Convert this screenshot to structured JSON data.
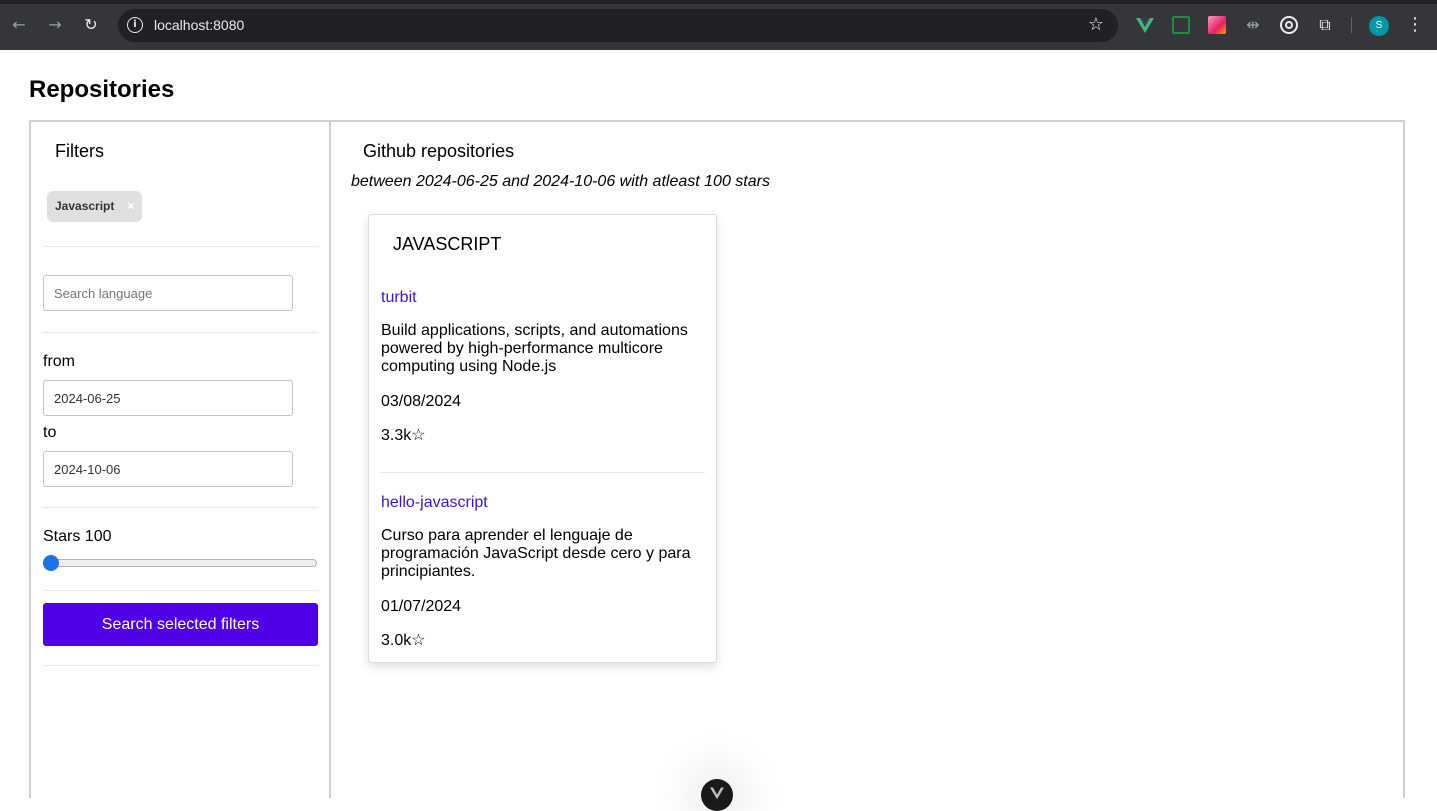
{
  "browser": {
    "url": "localhost:8080",
    "avatar_initial": "S",
    "back_icon": "←",
    "forward_icon": "→",
    "reload_icon": "↻",
    "info_icon": "i",
    "star_icon": "☆",
    "split_icon": "⇹",
    "puzzle_icon": "⧉",
    "menu_icon": "⋮"
  },
  "page": {
    "title": "Repositories"
  },
  "filters": {
    "title": "Filters",
    "selected_chip": "Javascript",
    "chip_remove": "×",
    "search_placeholder": "Search language",
    "from_label": "from",
    "from_value": "2024-06-25",
    "to_label": "to",
    "to_value": "2024-10-06",
    "stars_label": "Stars 100",
    "stars_value": 100,
    "submit_label": "Search selected filters"
  },
  "results": {
    "title": "Github repositories",
    "subtitle": "between 2024-06-25 and 2024-10-06 with atleast 100 stars",
    "groups": [
      {
        "language": "JAVASCRIPT",
        "repos": [
          {
            "name": "turbit",
            "description": "Build applications, scripts, and automations powered by high-performance multicore computing using Node.js",
            "date": "03/08/2024",
            "stars": "3.3k☆"
          },
          {
            "name": "hello-javascript",
            "description": "Curso para aprender el lenguaje de programación JavaScript desde cero y para principiantes.",
            "date": "01/07/2024",
            "stars": "3.0k☆"
          }
        ]
      }
    ]
  },
  "colors": {
    "accent": "#5000e6",
    "link": "#3a14d8",
    "vue_green": "#42b883"
  }
}
